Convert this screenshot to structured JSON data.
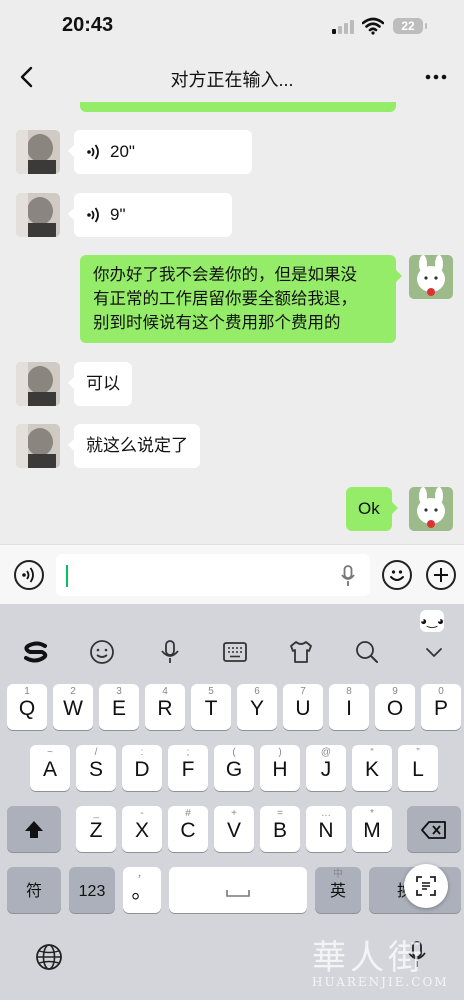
{
  "status_bar": {
    "time": "20:43",
    "battery": "22"
  },
  "nav": {
    "title": "对方正在输入..."
  },
  "messages": [
    {
      "side": "in",
      "kind": "voice",
      "text": "20\""
    },
    {
      "side": "in",
      "kind": "voice",
      "text": "9\""
    },
    {
      "side": "out",
      "kind": "text",
      "lines": [
        "你办好了我不会差你的，但是如果没",
        "有正常的工作居留你要全额给我退，",
        "别到时候说有这个费用那个费用的"
      ]
    },
    {
      "side": "in",
      "kind": "text",
      "text": "可以"
    },
    {
      "side": "in",
      "kind": "text",
      "text": "就这么说定了"
    },
    {
      "side": "out",
      "kind": "text",
      "text": "Ok"
    }
  ],
  "input": {
    "value": ""
  },
  "keyboard": {
    "row1": [
      {
        "k": "Q",
        "s": "1"
      },
      {
        "k": "W",
        "s": "2"
      },
      {
        "k": "E",
        "s": "3"
      },
      {
        "k": "R",
        "s": "4"
      },
      {
        "k": "T",
        "s": "5"
      },
      {
        "k": "Y",
        "s": "6"
      },
      {
        "k": "U",
        "s": "7"
      },
      {
        "k": "I",
        "s": "8"
      },
      {
        "k": "O",
        "s": "9"
      },
      {
        "k": "P",
        "s": "0"
      }
    ],
    "row2": [
      {
        "k": "A",
        "s": "~"
      },
      {
        "k": "S",
        "s": "/"
      },
      {
        "k": "D",
        "s": ":"
      },
      {
        "k": "F",
        "s": ";"
      },
      {
        "k": "G",
        "s": "("
      },
      {
        "k": "H",
        "s": ")"
      },
      {
        "k": "J",
        "s": "@"
      },
      {
        "k": "K",
        "s": "“"
      },
      {
        "k": "L",
        "s": "”"
      }
    ],
    "row3": [
      {
        "k": "Z",
        "s": "_"
      },
      {
        "k": "X",
        "s": "-"
      },
      {
        "k": "C",
        "s": "#"
      },
      {
        "k": "V",
        "s": "+"
      },
      {
        "k": "B",
        "s": "="
      },
      {
        "k": "N",
        "s": "…"
      },
      {
        "k": "M",
        "s": "*"
      }
    ],
    "sym_label": "符",
    "num_label": "123",
    "punct_sub": "，",
    "punct_label": "。",
    "lang_sub": "中",
    "lang_label": "英",
    "return_label": "换"
  },
  "watermark": {
    "cn": "華人街",
    "en": "HUARENJIE.COM"
  }
}
